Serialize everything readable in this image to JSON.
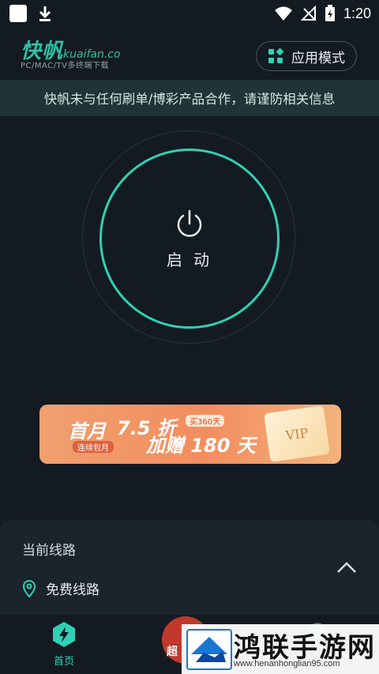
{
  "status": {
    "time": "1:20"
  },
  "header": {
    "logo_main": "快帆",
    "logo_url": "kuaifan.co",
    "logo_sub": "PC/MAC/TV多终端下载",
    "mode_button": "应用模式"
  },
  "notice": "快帆未与任何刷单/博彩产品合作，请谨防相关信息",
  "power": {
    "label": "启 动"
  },
  "banner": {
    "title": "首月",
    "subtitle": "连续包月",
    "discount": "7.5 折",
    "extra": "加赠 180 天",
    "buy_note": "买360天",
    "vip": "VIP"
  },
  "panel": {
    "title": "当前线路",
    "route": "免费线路"
  },
  "bottom_nav": {
    "home": "首页",
    "center_badge": "超"
  },
  "watermark": {
    "title": "鸿联手游网",
    "url": "www.henanhonglian95.com"
  },
  "colors": {
    "accent": "#2fd1b4",
    "background": "#141a22"
  }
}
